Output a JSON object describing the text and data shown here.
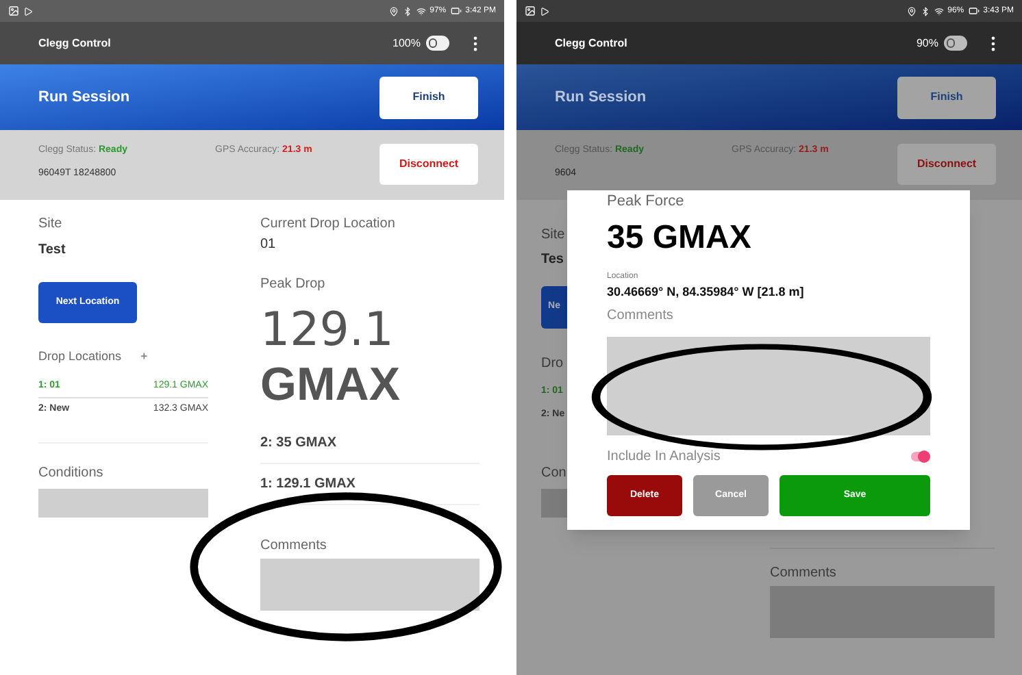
{
  "left_screen": {
    "status_bar": {
      "battery": "97%",
      "time": "3:42 PM"
    },
    "app_bar": {
      "title": "Clegg Control",
      "percent": "100%"
    },
    "header": {
      "title": "Run Session",
      "button": "Finish"
    },
    "info": {
      "status_label": "Clegg Status:",
      "status_value": "Ready",
      "gps_label": "GPS Accuracy:",
      "gps_value": "21.3 m",
      "serial": "96049T 18248800",
      "button": "Disconnect"
    },
    "site": {
      "label": "Site",
      "value": "Test"
    },
    "next_button": "Next Location",
    "drop_locations": {
      "title": "Drop Locations",
      "add": "+",
      "items": [
        {
          "name": "1: 01",
          "value": "129.1 GMAX",
          "selected": true
        },
        {
          "name": "2: New",
          "value": "132.3 GMAX",
          "selected": false
        }
      ]
    },
    "conditions": {
      "label": "Conditions"
    },
    "current_drop": {
      "label": "Current Drop Location",
      "value": "01"
    },
    "peak_drop": {
      "label": "Peak Drop",
      "value": "129.1",
      "unit": "GMAX"
    },
    "drops": [
      "2: 35 GMAX",
      "1: 129.1 GMAX"
    ],
    "comments": {
      "label": "Comments"
    }
  },
  "right_screen": {
    "status_bar": {
      "battery": "96%",
      "time": "3:43 PM"
    },
    "app_bar": {
      "title": "Clegg Control",
      "percent": "90%"
    },
    "header": {
      "title": "Run Session",
      "button": "Finish"
    },
    "info": {
      "status_label": "Clegg Status:",
      "status_value": "Ready",
      "gps_label": "GPS Accuracy:",
      "gps_value": "21.3 m",
      "serial": "9604",
      "button": "Disconnect"
    },
    "background_fragments": {
      "site_label": "Site",
      "site_value": "Tes",
      "button": "Ne",
      "drop_title": "Dro",
      "rows": [
        "1: 01",
        "2: Ne"
      ],
      "conditions": "Con"
    },
    "comments": {
      "label": "Comments"
    },
    "modal": {
      "title": "Peak Force",
      "value": "35 GMAX",
      "location_label": "Location",
      "location": "30.46669° N, 84.35984° W [21.8 m]",
      "comments_label": "Comments",
      "include_label": "Include In Analysis",
      "included": true,
      "buttons": {
        "delete": "Delete",
        "cancel": "Cancel",
        "save": "Save"
      }
    }
  }
}
